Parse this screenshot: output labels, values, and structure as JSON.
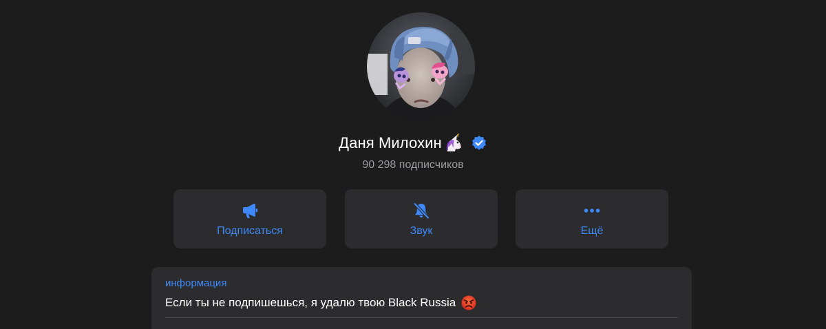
{
  "profile": {
    "name": "Даня Милохин",
    "name_emoji": "unicorn-emoji",
    "verified": true,
    "subscribers": "90 298 подписчиков"
  },
  "actions": [
    {
      "label": "Подписаться",
      "icon": "megaphone-icon"
    },
    {
      "label": "Звук",
      "icon": "bell-muted-icon"
    },
    {
      "label": "Ещё",
      "icon": "more-dots-icon"
    }
  ],
  "info": {
    "label": "информация",
    "text": "Если ты не подпишешься, я удалю твою Black Russia",
    "text_emoji": "angry-face-emoji"
  },
  "colors": {
    "background": "#1c1c1d",
    "card": "#2c2c2e",
    "accent": "#3e88f7",
    "secondary_text": "#9a9a9e",
    "verified": "#3e88f7"
  }
}
